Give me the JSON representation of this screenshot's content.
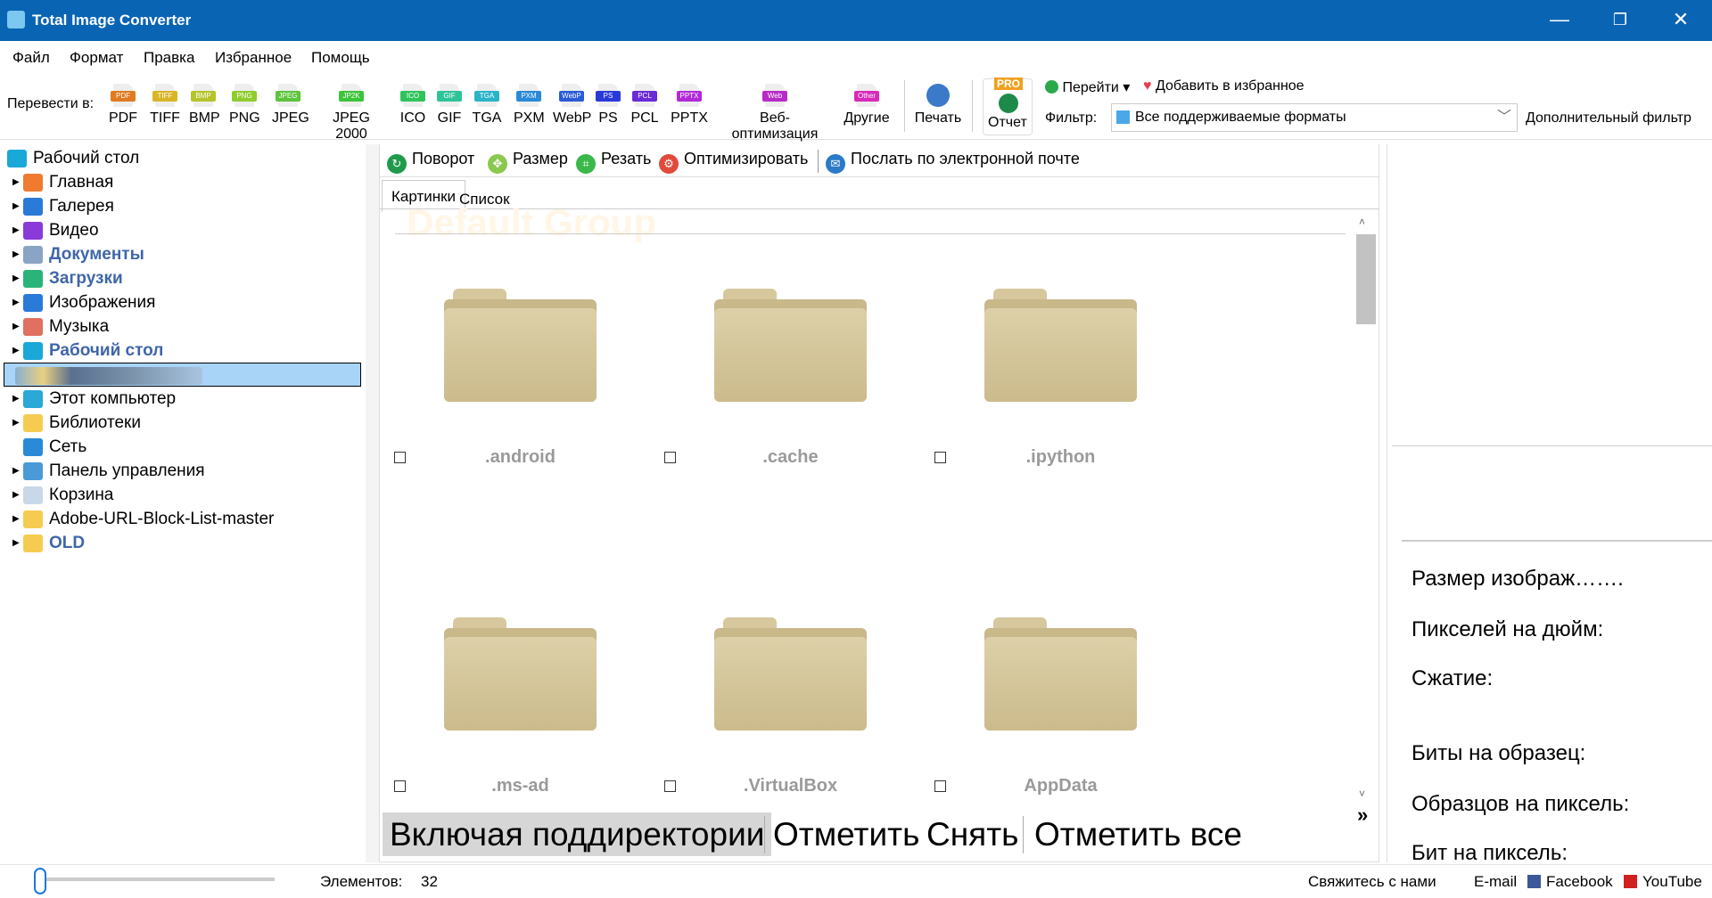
{
  "window": {
    "title": "Total Image Converter",
    "minimize": "—",
    "restore": "❐",
    "close": "✕"
  },
  "menu": [
    "Файл",
    "Формат",
    "Правка",
    "Избранное",
    "Помощь"
  ],
  "toolbar": {
    "convert_label": "Перевести в:",
    "formats": [
      {
        "label": "PDF",
        "tag": "PDF",
        "color": "#e07b1f"
      },
      {
        "label": "TIFF",
        "tag": "TIFF",
        "color": "#d9b526"
      },
      {
        "label": "BMP",
        "tag": "BMP",
        "color": "#b5c42a"
      },
      {
        "label": "PNG",
        "tag": "PNG",
        "color": "#8fcc2e"
      },
      {
        "label": "JPEG",
        "tag": "JPEG",
        "color": "#5cc43a"
      },
      {
        "label": "JPEG 2000",
        "tag": "JP2K",
        "color": "#3cc43a"
      },
      {
        "label": "ICO",
        "tag": "ICO",
        "color": "#2ec45a"
      },
      {
        "label": "GIF",
        "tag": "GIF",
        "color": "#2ec49a"
      },
      {
        "label": "TGA",
        "tag": "TGA",
        "color": "#2ab4c8"
      },
      {
        "label": "PXM",
        "tag": "PXM",
        "color": "#2a8ad8"
      },
      {
        "label": "WebP",
        "tag": "WebP",
        "color": "#2a5ad8"
      },
      {
        "label": "PS",
        "tag": "PS",
        "color": "#2a3ad8"
      },
      {
        "label": "PCL",
        "tag": "PCL",
        "color": "#6a2ad8"
      },
      {
        "label": "PPTX",
        "tag": "PPTX",
        "color": "#b02ad8"
      },
      {
        "label": "Веб-оптимизация",
        "tag": "Web",
        "color": "#b82ac8"
      },
      {
        "label": "Другие",
        "tag": "Other",
        "color": "#d82ab8"
      }
    ],
    "print": "Печать",
    "report": "Отчет",
    "pro_badge": "PRO",
    "goto": "Перейти",
    "add_favorite": "Добавить в избранное",
    "filter_label": "Фильтр:",
    "filter_value": "Все поддерживаемые форматы",
    "extra_filter": "Дополнительный фильтр"
  },
  "tree": {
    "root": "Рабочий стол",
    "items": [
      {
        "label": "Главная",
        "color": "#f07a30",
        "bold": false
      },
      {
        "label": "Галерея",
        "color": "#2a7ad8",
        "bold": false
      },
      {
        "label": "Видео",
        "color": "#8a3ad8",
        "bold": false
      },
      {
        "label": "Документы",
        "color": "#8aa4c4",
        "bold": true
      },
      {
        "label": "Загрузки",
        "color": "#2ab47a",
        "bold": true
      },
      {
        "label": "Изображения",
        "color": "#2a7ad8",
        "bold": false
      },
      {
        "label": "Музыка",
        "color": "#e07060",
        "bold": false
      },
      {
        "label": "Рабочий стол",
        "color": "#1aa8d8",
        "bold": true
      },
      {
        "label": "",
        "color": "#a8d4f8",
        "bold": false,
        "selected": true
      },
      {
        "label": "Этот компьютер",
        "color": "#2aa8d8",
        "bold": false
      },
      {
        "label": "Библиотеки",
        "color": "#f5cc50",
        "bold": false
      },
      {
        "label": "Сеть",
        "color": "#2a8ad8",
        "bold": false,
        "noarrow": true
      },
      {
        "label": "Панель управления",
        "color": "#4a9ad8",
        "bold": false
      },
      {
        "label": "Корзина",
        "color": "#c8d8e8",
        "bold": false
      },
      {
        "label": "Adobe-URL-Block-List-master",
        "color": "#f5cc50",
        "bold": false
      },
      {
        "label": "OLD",
        "color": "#f5cc50",
        "bold": true
      }
    ]
  },
  "actions": {
    "rotate": "Поворот",
    "resize": "Размер",
    "crop": "Резать",
    "optimize": "Оптимизировать",
    "email": "Послать по электронной почте"
  },
  "tabs": {
    "pictures": "Картинки",
    "list": "Список"
  },
  "group_watermark": "Default Group",
  "folders": [
    ".android",
    ".cache",
    ".ipython",
    ".ms-ad",
    ".VirtualBox",
    "AppData"
  ],
  "bottom_buttons": {
    "subdirs": "Включая поддиректории",
    "mark": "Отметить",
    "unmark": "Снять",
    "mark_all": "Отметить все",
    "more": "»"
  },
  "info": {
    "size": "Размер изображ…….",
    "ppi": "Пикселей на дюйм:",
    "compression": "Сжатие:",
    "bits_sample": "Биты на образец:",
    "samples_pixel": "Образцов на пиксель:",
    "bits_pixel": "Бит на пиксель:"
  },
  "status": {
    "elements_label": "Элементов:",
    "elements_count": "32",
    "contact": "Свяжитесь с нами",
    "email": "E-mail",
    "facebook": "Facebook",
    "youtube": "YouTube",
    "zoom_slider": 0
  }
}
